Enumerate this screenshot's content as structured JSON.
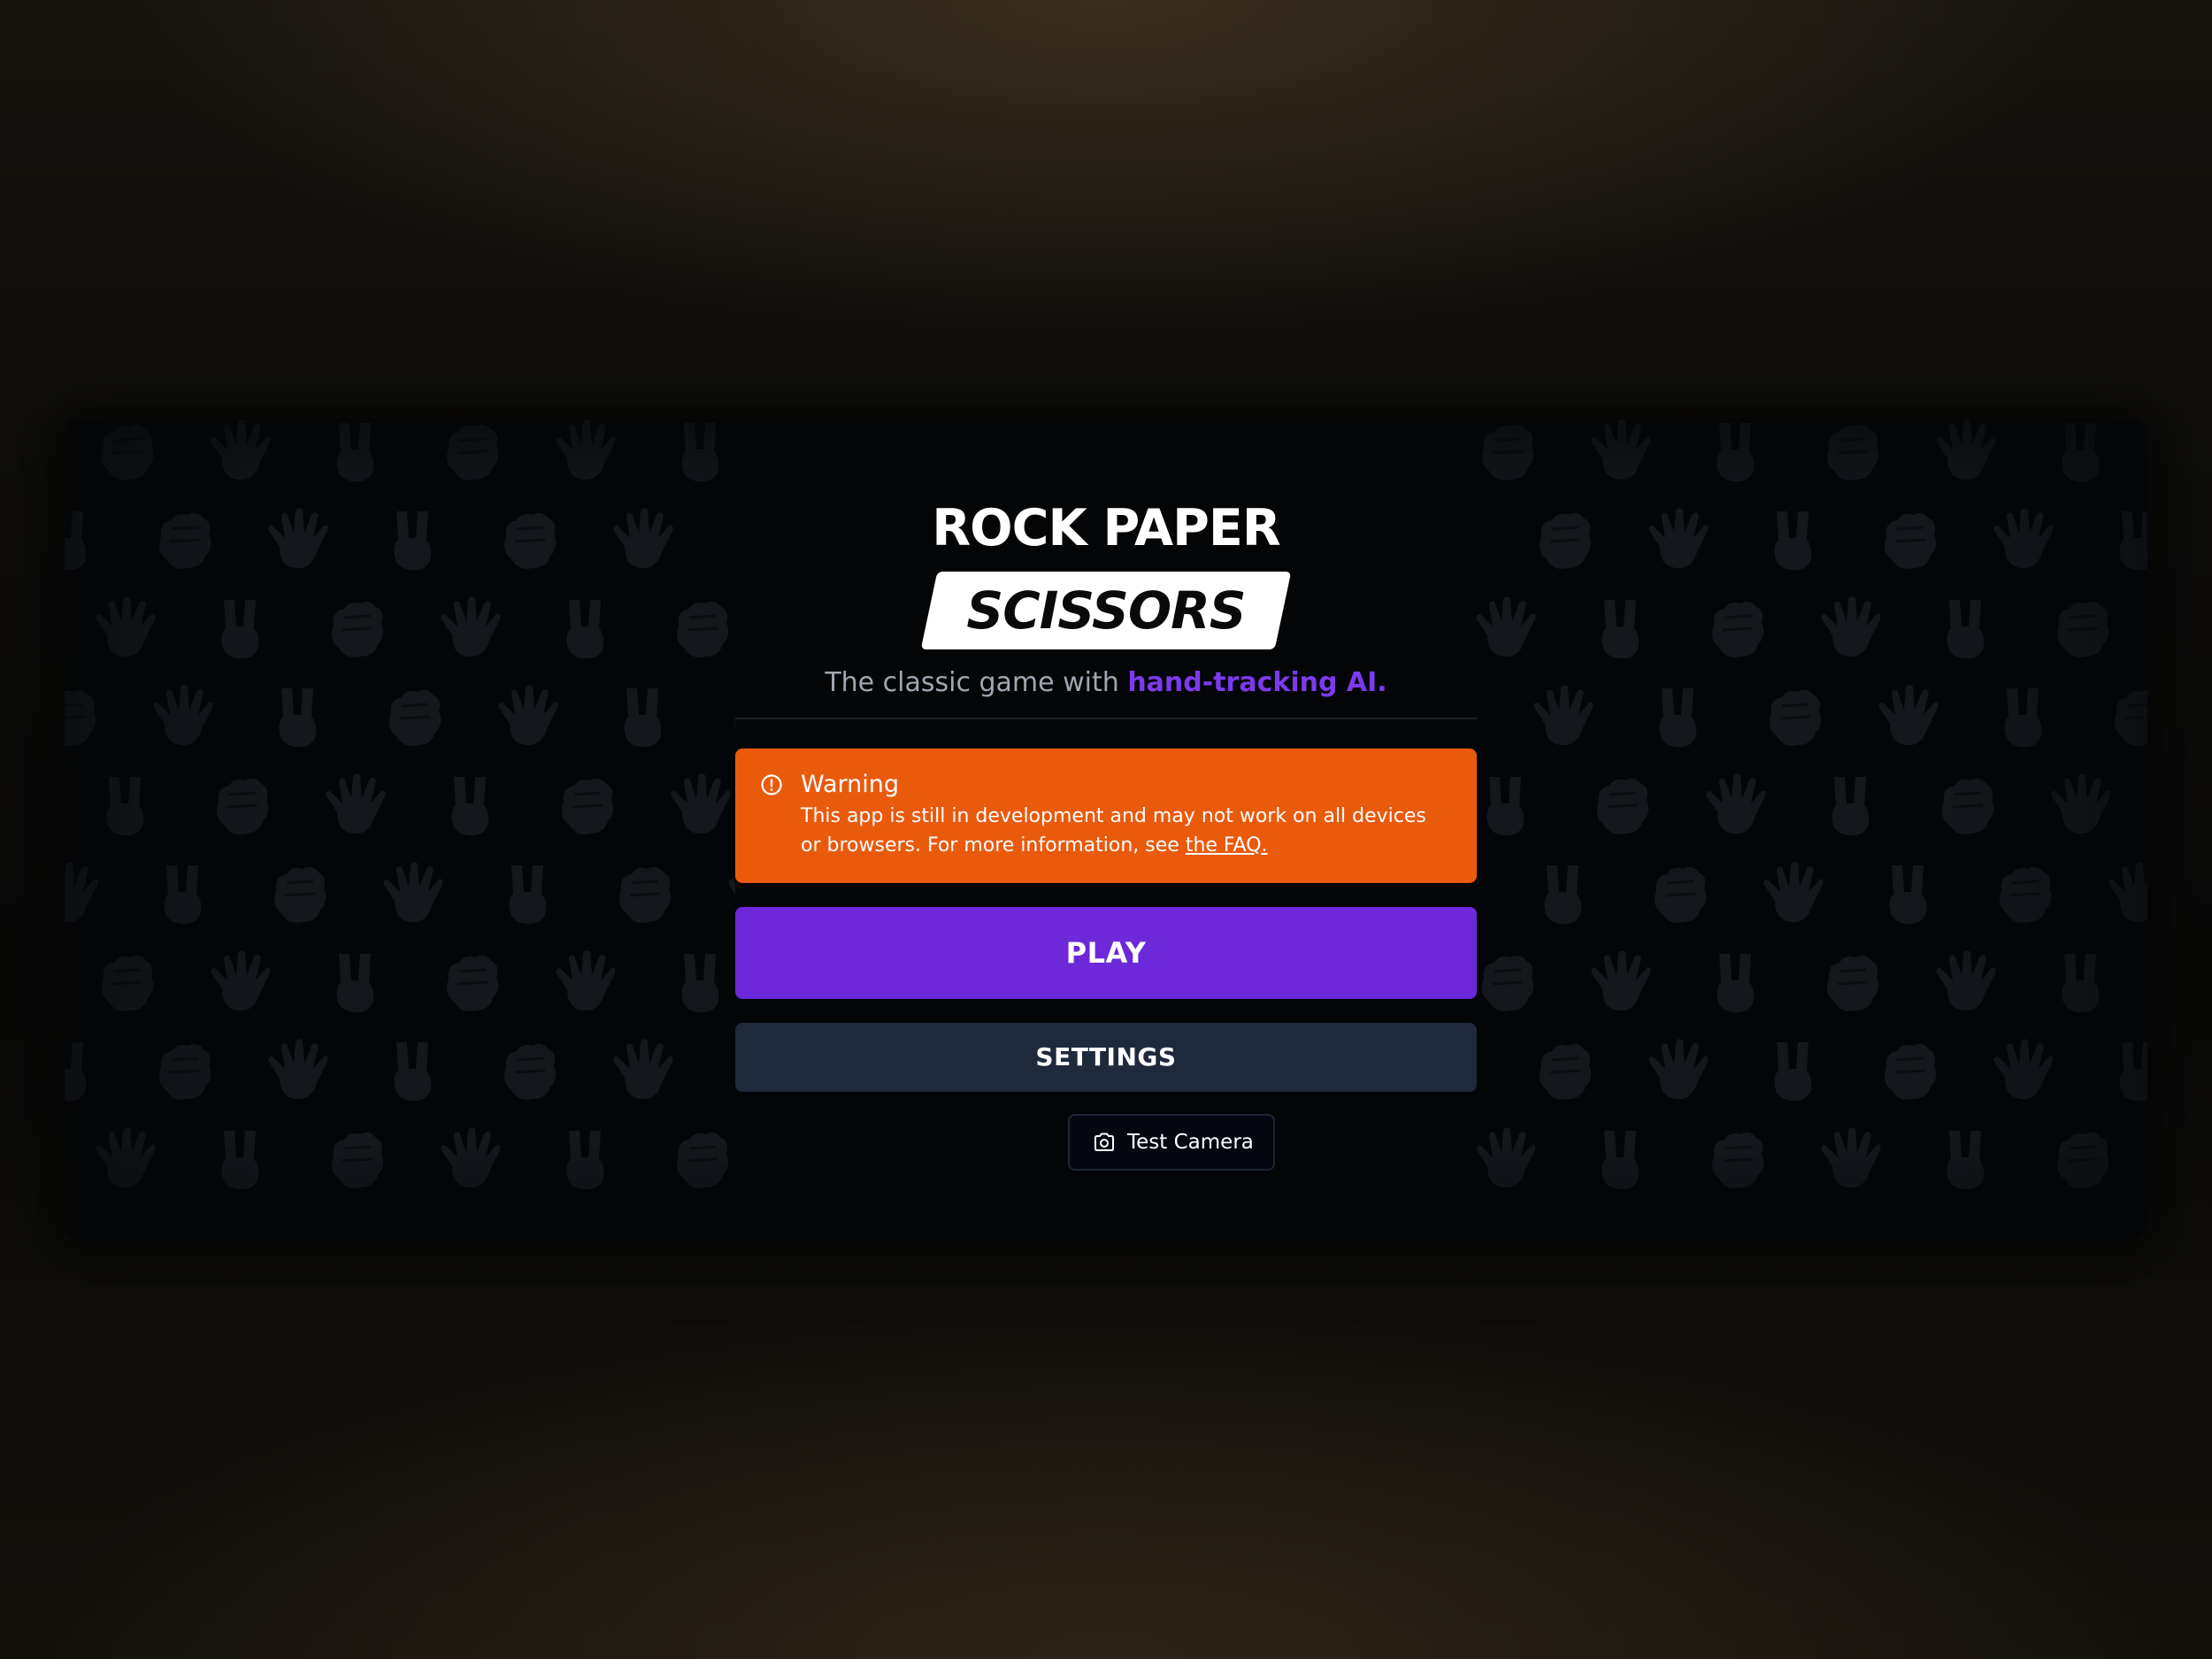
{
  "app": {
    "logo_top": "ROCK PAPER",
    "logo_bottom": "SCISSORS",
    "tagline_prefix": "The classic game with ",
    "tagline_accent": "hand-tracking AI.",
    "accent_color": "#7c3aed"
  },
  "warning": {
    "title": "Warning",
    "body": "This app is still in development and may not work on all devices or browsers. For more information, see ",
    "link": "the FAQ.",
    "icon": "alert-circle-icon",
    "color": "#ea5a0c"
  },
  "buttons": {
    "play": "PLAY",
    "play_color": "#6d28d9",
    "settings": "SETTINGS",
    "settings_color": "#1e293b",
    "test_camera": "Test Camera",
    "test_camera_icon": "camera-icon"
  },
  "background": {
    "pattern_icons": [
      "rock-hand-icon",
      "paper-hand-icon",
      "scissors-hand-icon"
    ]
  }
}
